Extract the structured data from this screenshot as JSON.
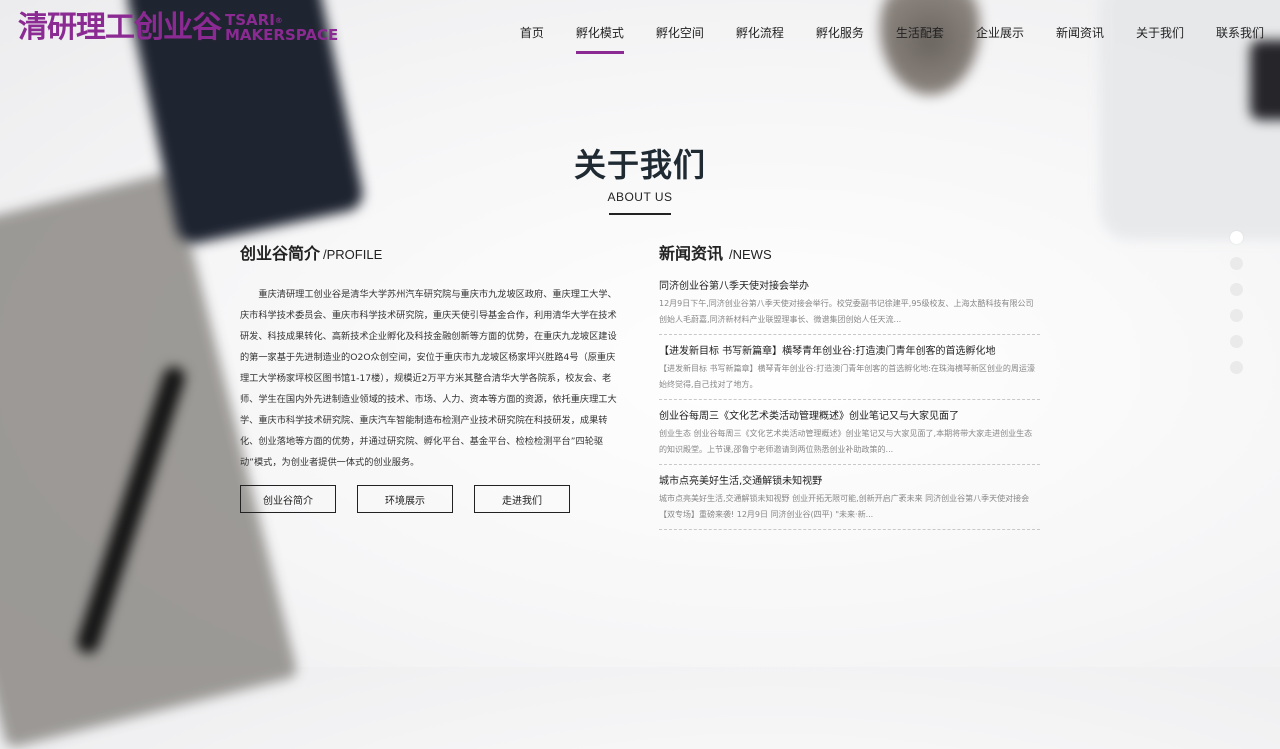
{
  "logo": {
    "cn": "清研理工创业谷",
    "en_line1": "TSARI",
    "en_line2": "MAKERSPACE",
    "reg": "®"
  },
  "nav": {
    "items": [
      {
        "label": "首页"
      },
      {
        "label": "孵化模式"
      },
      {
        "label": "孵化空间"
      },
      {
        "label": "孵化流程"
      },
      {
        "label": "孵化服务"
      },
      {
        "label": "生活配套"
      },
      {
        "label": "企业展示"
      },
      {
        "label": "新闻资讯"
      },
      {
        "label": "关于我们"
      },
      {
        "label": "联系我们"
      }
    ],
    "active_index": 1
  },
  "colors": {
    "accent": "#8b2a92",
    "title": "#1f2a33"
  },
  "section": {
    "title_cn": "关于我们",
    "title_en": "ABOUT US"
  },
  "profile": {
    "title": "创业谷简介",
    "subtitle": "/PROFILE",
    "text": "重庆清研理工创业谷是清华大学苏州汽车研究院与重庆市九龙坡区政府、重庆理工大学、庆市科学技术委员会、重庆市科学技术研究院，重庆天使引导基金合作，利用清华大学在技术研发、科技成果转化、高新技术企业孵化及科技金融创新等方面的优势，在重庆九龙坡区建设的第一家基于先进制造业的O2O众创空间，安位于重庆市九龙坡区杨家坪兴胜路4号（原重庆理工大学杨家坪校区图书馆1-17楼），规模近2万平方米其整合清华大学各院系，校友会、老师、学生在国内外先进制造业领域的技术、市场、人力、资本等方面的资源，依托重庆理工大学、重庆市科学技术研究院、重庆汽车智能制造布检测产业技术研究院在科技研发，成果转化、创业落地等方面的优势，并通过研究院、孵化平台、基金平台、检检检测平台”四轮驱动”模式，为创业者提供一体式的创业服务。",
    "buttons": [
      "创业谷简介",
      "环境展示",
      "走进我们"
    ]
  },
  "news": {
    "title": "新闻资讯",
    "subtitle": "/NEWS",
    "items": [
      {
        "title": "同济创业谷第八季天使对接会举办",
        "desc": "12月9日下午,同济创业谷第八季天使对接会举行。校党委副书记徐建平,95级校友、上海太酷科技有限公司创始人毛蔚嘉,同济新材料产业联盟理事长、微谱集团创始人任天流..."
      },
      {
        "title": "【进发新目标 书写新篇章】横琴青年创业谷:打造澳门青年创客的首选孵化地",
        "desc": "【进发新目标 书写新篇章】横琴青年创业谷:打造澳门青年创客的首选孵化地:在珠海横琴新区创业的周运濠始终觉得,自己找对了地方。"
      },
      {
        "title": "创业谷每周三《文化艺术类活动管理概述》创业笔记又与大家见面了",
        "desc": "创业生态 创业谷每周三《文化艺术类活动管理概述》创业笔记又与大家见面了,本期将带大家走进创业生态的知识殿堂。上节课,邵鲁宁老师邀请到两位熟悉创业补助政策的..."
      },
      {
        "title": "城市点亮美好生活,交通解锁未知视野",
        "desc": "城市点亮美好生活,交通解锁未知视野 创业开拓无限可能,创新开启广袤未来 同济创业谷第八季天使对接会【双专场】重磅来袭! 12月9日 同济创业谷(四平) \"未来·新..."
      }
    ]
  },
  "pager": {
    "count": 6,
    "active_index": 0
  }
}
